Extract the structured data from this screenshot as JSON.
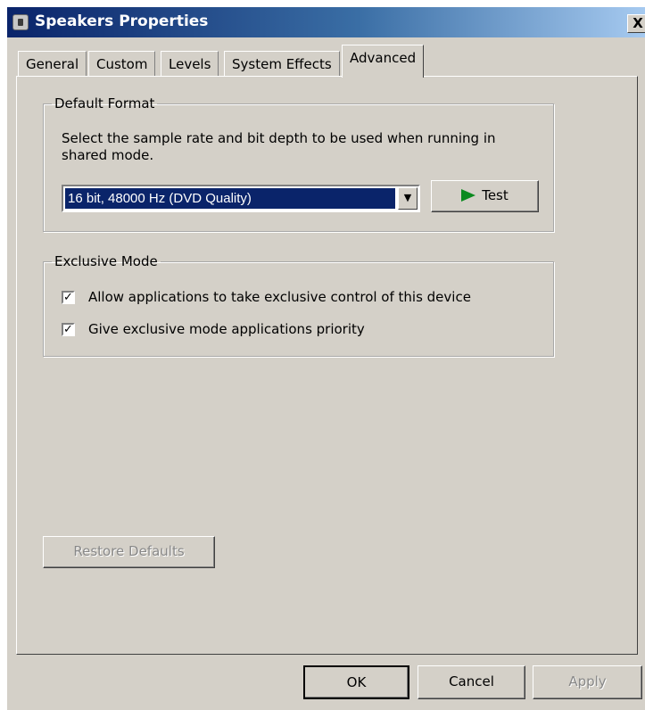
{
  "window": {
    "title": "Speakers Properties",
    "close_label": "X"
  },
  "tabs": [
    {
      "label": "General"
    },
    {
      "label": "Custom"
    },
    {
      "label": "Levels"
    },
    {
      "label": "System Effects"
    },
    {
      "label": "Advanced",
      "active": true
    }
  ],
  "default_format": {
    "legend": "Default Format",
    "description": "Select the sample rate and bit depth to be used when running in shared mode.",
    "selected_value": "16 bit, 48000 Hz (DVD Quality)",
    "test_label": "Test"
  },
  "exclusive_mode": {
    "legend": "Exclusive Mode",
    "allow_label": "Allow applications to take exclusive control of this device",
    "allow_checked": true,
    "priority_label": "Give exclusive mode applications priority",
    "priority_checked": true
  },
  "restore_label": "Restore Defaults",
  "buttons": {
    "ok": "OK",
    "cancel": "Cancel",
    "apply": "Apply"
  },
  "colors": {
    "titlebar": "#0a246a",
    "face": "#d4d0c8",
    "selection": "#0a246a",
    "play": "#0b8a1f"
  }
}
